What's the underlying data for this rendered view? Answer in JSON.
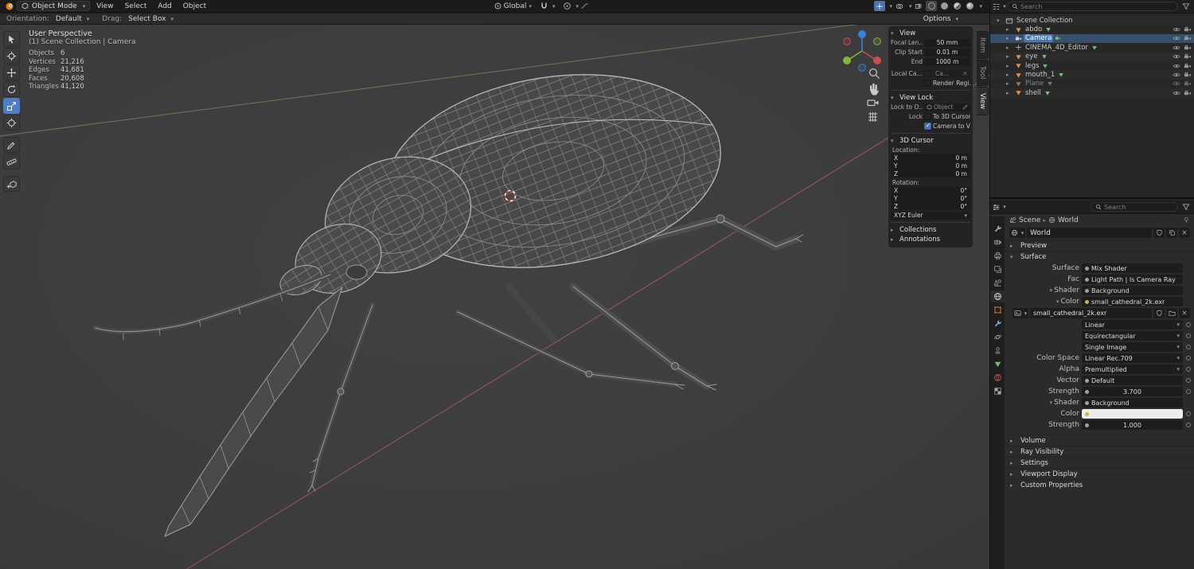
{
  "colors": {
    "accent": "#4772b3",
    "selected_row": "#35506d",
    "axis_x": "#cc4d4d",
    "axis_y": "#84b43a",
    "axis_z": "#3b7fdd"
  },
  "topbar": {
    "mode": "Object Mode",
    "menus": [
      {
        "label": "View"
      },
      {
        "label": "Select"
      },
      {
        "label": "Add"
      },
      {
        "label": "Object"
      }
    ],
    "transform_orientation": "Global"
  },
  "toolheader": {
    "orientation_label": "Orientation:",
    "orientation_value": "Default",
    "drag_label": "Drag:",
    "drag_value": "Select Box",
    "options_label": "Options"
  },
  "viewport": {
    "title": "User Perspective",
    "subtitle": "(1) Scene Collection | Camera",
    "stats": [
      {
        "label": "Objects",
        "value": "6"
      },
      {
        "label": "Vertices",
        "value": "21,216"
      },
      {
        "label": "Edges",
        "value": "41,681"
      },
      {
        "label": "Faces",
        "value": "20,608"
      },
      {
        "label": "Triangles",
        "value": "41,120"
      }
    ],
    "side_tabs": [
      {
        "label": "Item"
      },
      {
        "label": "Tool"
      },
      {
        "label": "View"
      }
    ]
  },
  "npanel": {
    "view": {
      "title": "View",
      "focal_label": "Focal Len…",
      "focal_value": "50 mm",
      "clip_start_label": "Clip Start",
      "clip_start_value": "0.01 m",
      "clip_end_label": "End",
      "clip_end_value": "1000 m",
      "local_camera_label": "Local Ca…",
      "local_camera_value": "Ca…",
      "render_region_label": "Render Regi…"
    },
    "view_lock": {
      "title": "View Lock",
      "lock_to_label": "Lock to O…",
      "lock_to_placeholder": "Object",
      "lock_label": "Lock",
      "to_3d_cursor_label": "To 3D Cursor",
      "camera_to_view_label": "Camera to V…"
    },
    "cursor": {
      "title": "3D Cursor",
      "location_label": "Location:",
      "loc": [
        {
          "axis": "X",
          "value": "0 m"
        },
        {
          "axis": "Y",
          "value": "0 m"
        },
        {
          "axis": "Z",
          "value": "0 m"
        }
      ],
      "rotation_label": "Rotation:",
      "rot": [
        {
          "axis": "X",
          "value": "0°"
        },
        {
          "axis": "Y",
          "value": "0°"
        },
        {
          "axis": "Z",
          "value": "0°"
        }
      ],
      "euler_mode": "XYZ Euler"
    },
    "collections_title": "Collections",
    "annotations_title": "Annotations"
  },
  "outliner": {
    "search_placeholder": "Search",
    "root_label": "Scene Collection",
    "items": [
      {
        "name": "abdo"
      },
      {
        "name": "Camera"
      },
      {
        "name": "CINEMA_4D_Editor"
      },
      {
        "name": "eye"
      },
      {
        "name": "legs"
      },
      {
        "name": "mouth_1"
      },
      {
        "name": "Plane"
      },
      {
        "name": "shell"
      }
    ]
  },
  "properties": {
    "search_placeholder": "Search",
    "breadcrumb": {
      "scene": "Scene",
      "world": "World"
    },
    "world_block_name": "World",
    "sections": {
      "preview": "Preview",
      "surface": "Surface",
      "volume": "Volume",
      "ray_visibility": "Ray Visibility",
      "settings": "Settings",
      "viewport_display": "Viewport Display",
      "custom_properties": "Custom Properties"
    },
    "surface": {
      "surface_label": "Surface",
      "surface_value": "Mix Shader",
      "fac_label": "Fac",
      "fac_value": "Light Path | Is Camera Ray",
      "shader_label": "Shader",
      "shader_value": "Background",
      "color_label": "Color",
      "color_value": "small_cathedral_2k.exr",
      "image_name": "small_cathedral_2k.exr",
      "interp": "Linear",
      "projection": "Equirectangular",
      "source": "Single Image",
      "color_space_label": "Color Space",
      "color_space_value": "Linear Rec.709",
      "alpha_label": "Alpha",
      "alpha_value": "Premultiplied",
      "vector_label": "Vector",
      "vector_value": "Default",
      "strength_label": "Strength",
      "strength_value": "3.700",
      "shader2_label": "Shader",
      "shader2_value": "Background",
      "color2_label": "Color",
      "strength2_label": "Strength",
      "strength2_value": "1.000"
    }
  }
}
